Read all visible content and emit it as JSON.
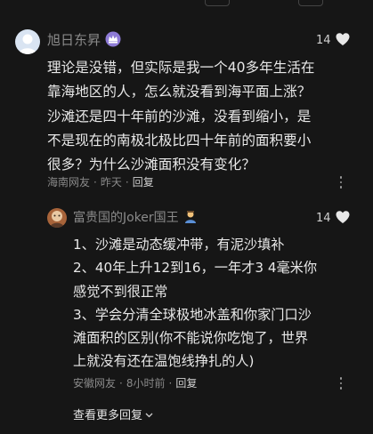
{
  "colors": {
    "background": "#161616",
    "text": "#e8e8e8",
    "muted": "#8a8a8a",
    "badge_purple": "#8e7bd6"
  },
  "comment": {
    "username": "旭日东昇",
    "badge_icon": "level-badge-icon",
    "likes": "14",
    "lines": [
      "理论是没错，但实际是我一个40多年生活在",
      "靠海地区的人，怎么就没看到海平面上涨？",
      "沙滩还是四十年前的沙滩，没看到缩小，是",
      "不是现在的南极北极比四十年前的面积要小",
      "很多？为什么沙滩面积没有变化？"
    ],
    "location": "海南网友",
    "time": "昨天",
    "reply_label": "回复"
  },
  "reply": {
    "username": "富贵国的Joker国王",
    "badge_icon": "emoji-person-icon",
    "likes": "14",
    "lines": [
      "1、沙滩是动态缓冲带，有泥沙填补",
      "2、40年上升12到16，一年才3 4毫米你",
      "感觉不到很正常",
      "3、学会分清全球极地冰盖和你家门口沙",
      "滩面积的区别(你不能说你吃饱了，世界",
      "上就没有还在温饱线挣扎的人)"
    ],
    "location": "安徽网友",
    "time": "8小时前",
    "reply_label": "回复"
  },
  "see_more": "查看更多回复"
}
